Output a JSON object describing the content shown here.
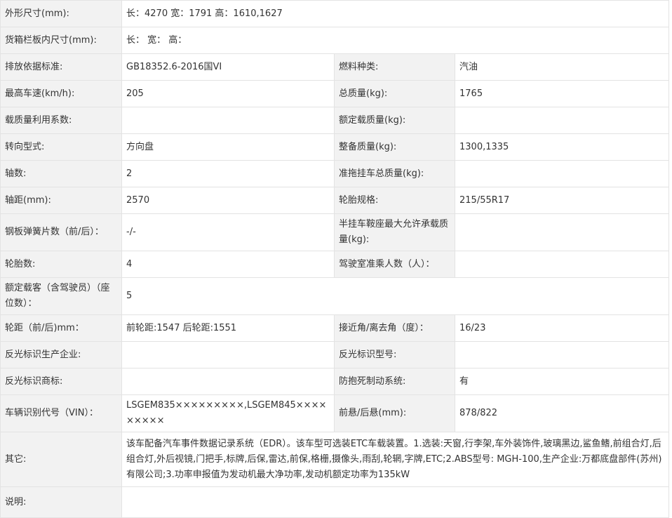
{
  "rows": [
    {
      "cells": [
        {
          "t": "外形尺寸(mm):",
          "k": "lab"
        },
        {
          "t": "长：4270 宽：1791 高：1610,1627",
          "k": "val",
          "span": 3
        }
      ]
    },
    {
      "cells": [
        {
          "t": "货箱栏板内尺寸(mm):",
          "k": "lab"
        },
        {
          "t": "长： 宽： 高：",
          "k": "val",
          "span": 3
        }
      ]
    },
    {
      "cells": [
        {
          "t": "排放依据标准:",
          "k": "lab"
        },
        {
          "t": "GB18352.6-2016国VI",
          "k": "val"
        },
        {
          "t": "燃料种类:",
          "k": "lab"
        },
        {
          "t": "汽油",
          "k": "val"
        }
      ]
    },
    {
      "cells": [
        {
          "t": "最高车速(km/h):",
          "k": "lab"
        },
        {
          "t": "205",
          "k": "val"
        },
        {
          "t": "总质量(kg):",
          "k": "lab"
        },
        {
          "t": "1765",
          "k": "val"
        }
      ]
    },
    {
      "cells": [
        {
          "t": "载质量利用系数:",
          "k": "lab"
        },
        {
          "t": "",
          "k": "val"
        },
        {
          "t": "额定载质量(kg):",
          "k": "lab"
        },
        {
          "t": "",
          "k": "val"
        }
      ]
    },
    {
      "cells": [
        {
          "t": "转向型式:",
          "k": "lab"
        },
        {
          "t": "方向盘",
          "k": "val"
        },
        {
          "t": "整备质量(kg):",
          "k": "lab"
        },
        {
          "t": "1300,1335",
          "k": "val"
        }
      ]
    },
    {
      "cells": [
        {
          "t": "轴数:",
          "k": "lab"
        },
        {
          "t": "2",
          "k": "val"
        },
        {
          "t": "准拖挂车总质量(kg):",
          "k": "lab"
        },
        {
          "t": "",
          "k": "val"
        }
      ]
    },
    {
      "cells": [
        {
          "t": "轴距(mm):",
          "k": "lab"
        },
        {
          "t": "2570",
          "k": "val"
        },
        {
          "t": "轮胎规格:",
          "k": "lab"
        },
        {
          "t": "215/55R17",
          "k": "val"
        }
      ]
    },
    {
      "h": "h53",
      "cells": [
        {
          "t": "钢板弹簧片数（前/后）：",
          "k": "lab"
        },
        {
          "t": "-/-",
          "k": "val"
        },
        {
          "t": "半挂车鞍座最大允许承载质量(kg):",
          "k": "lab"
        },
        {
          "t": "",
          "k": "val"
        }
      ]
    },
    {
      "cells": [
        {
          "t": "轮胎数:",
          "k": "lab"
        },
        {
          "t": "4",
          "k": "val"
        },
        {
          "t": "驾驶室准乘人数（人）：",
          "k": "lab"
        },
        {
          "t": "",
          "k": "val"
        }
      ]
    },
    {
      "h": "h53",
      "cells": [
        {
          "t": "额定载客（含驾驶员）（座位数）：",
          "k": "lab"
        },
        {
          "t": "5",
          "k": "val",
          "span": 3
        }
      ]
    },
    {
      "cells": [
        {
          "t": "轮距（前/后)mm：",
          "k": "lab"
        },
        {
          "t": "前轮距:1547 后轮距:1551",
          "k": "val"
        },
        {
          "t": "接近角/离去角（度）：",
          "k": "lab"
        },
        {
          "t": "16/23",
          "k": "val"
        }
      ]
    },
    {
      "cells": [
        {
          "t": "反光标识生产企业:",
          "k": "lab"
        },
        {
          "t": "",
          "k": "val"
        },
        {
          "t": "反光标识型号:",
          "k": "lab"
        },
        {
          "t": "",
          "k": "val"
        }
      ]
    },
    {
      "cells": [
        {
          "t": "反光标识商标:",
          "k": "lab"
        },
        {
          "t": "",
          "k": "val"
        },
        {
          "t": "防抱死制动系统:",
          "k": "lab"
        },
        {
          "t": "有",
          "k": "val"
        }
      ]
    },
    {
      "h": "h53",
      "cells": [
        {
          "t": "车辆识别代号（VIN）：",
          "k": "lab"
        },
        {
          "t": "LSGEM835×××××××××,LSGEM845×××××××××",
          "k": "val"
        },
        {
          "t": "前悬/后悬(mm):",
          "k": "lab"
        },
        {
          "t": "878/822",
          "k": "val"
        }
      ]
    },
    {
      "h": "h78",
      "cells": [
        {
          "t": "其它:",
          "k": "lab"
        },
        {
          "t": "该车配备汽车事件数据记录系统（EDR）。该车型可选装ETC车载装置。1.选装:天窗,行李架,车外装饰件,玻璃黑边,鲨鱼鳍,前组合灯,后组合灯,外后视镜,门把手,标牌,后保,雷达,前保,格栅,摄像头,雨刮,轮辋,字牌,ETC;2.ABS型号: MGH-100,生产企业:万都底盘部件(苏州)有限公司;3.功率申报值为发动机最大净功率,发动机额定功率为135kW",
          "k": "val",
          "span": 3
        }
      ]
    },
    {
      "h": "h44",
      "cells": [
        {
          "t": "说明:",
          "k": "lab"
        },
        {
          "t": "",
          "k": "val",
          "span": 3
        }
      ]
    }
  ]
}
